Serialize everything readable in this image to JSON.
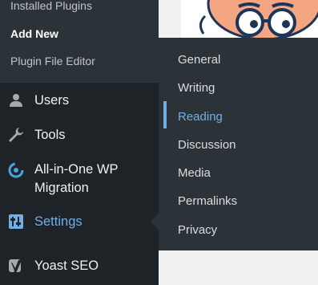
{
  "plugins_submenu": {
    "items": [
      {
        "label": "Installed Plugins",
        "current": false
      },
      {
        "label": "Add New",
        "current": true
      },
      {
        "label": "Plugin File Editor",
        "current": false
      }
    ]
  },
  "menu": {
    "users": {
      "label": "Users",
      "icon": "users-icon"
    },
    "tools": {
      "label": "Tools",
      "icon": "wrench-icon"
    },
    "migration": {
      "label_line1": "All-in-One WP",
      "label_line2": "Migration",
      "icon": "migration-icon"
    },
    "settings": {
      "label": "Settings",
      "icon": "settings-icon"
    },
    "yoast": {
      "label": "Yoast SEO",
      "icon": "yoast-icon"
    }
  },
  "settings_flyout": {
    "items": [
      {
        "label": "General",
        "active": false
      },
      {
        "label": "Writing",
        "active": false
      },
      {
        "label": "Reading",
        "active": true
      },
      {
        "label": "Discussion",
        "active": false
      },
      {
        "label": "Media",
        "active": false
      },
      {
        "label": "Permalinks",
        "active": false
      },
      {
        "label": "Privacy",
        "active": false
      }
    ]
  },
  "colors": {
    "sidebar_bg": "#1d2327",
    "submenu_bg": "#2c3338",
    "accent": "#72aee6",
    "text": "#f0f0f1",
    "subtext": "#c3c4c7"
  }
}
